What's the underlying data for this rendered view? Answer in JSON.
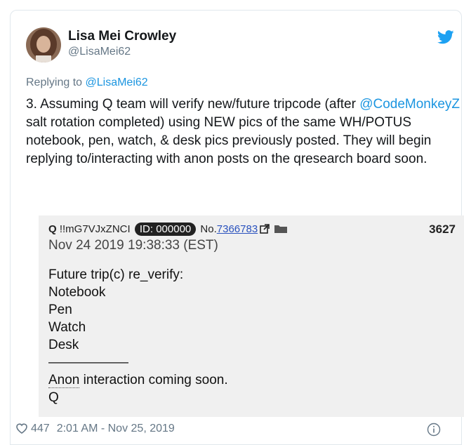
{
  "tweet": {
    "author_name": "Lisa Mei Crowley",
    "author_handle": "@LisaMei62",
    "replying_prefix": "Replying to ",
    "replying_to": "@LisaMei62",
    "body_part1": "3. Assuming Q team will verify new/future tripcode (after ",
    "body_mention": "@CodeMonkeyZ",
    "body_part2": " salt rotation completed) using NEW pics of the same WH/POTUS notebook, pen, watch, & desk pics previously posted. They will begin replying to/interacting with anon posts on the qresearch board soon.",
    "likes": "447",
    "timestamp": "2:01 AM - Nov 25, 2019"
  },
  "qpost": {
    "poster": "Q",
    "tripcode": " !!mG7VJxZNCI ",
    "id_badge": "ID: 000000",
    "no_prefix": " No.",
    "post_no": "7366783",
    "counter": "3627",
    "date": "Nov 24 2019 19:38:33 (EST)",
    "lines": [
      "Future trip(c) re_verify:",
      "Notebook",
      "Pen",
      "Watch",
      "Desk",
      "——————"
    ],
    "anon_word": "Anon",
    "anon_rest": " interaction coming soon.",
    "signoff": "Q"
  },
  "icons": {
    "brand": "twitter-bird-icon",
    "external": "external-link-icon",
    "folder": "folder-icon",
    "like": "heart-icon",
    "info": "info-icon"
  },
  "colors": {
    "twitter_blue": "#1da1f2",
    "link_blue": "#1b95e0",
    "muted": "#657786",
    "post_bg": "#f0f0f0"
  }
}
